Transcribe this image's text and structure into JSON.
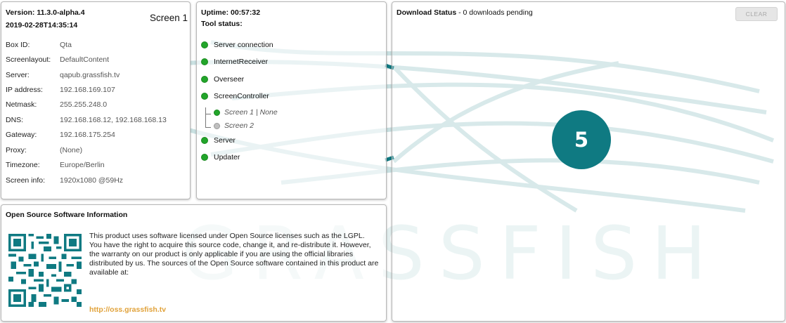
{
  "info": {
    "version": "Version: 11.3.0-alpha.4",
    "date": "2019-02-28T14:35:14",
    "screen": "Screen 1",
    "rows": [
      {
        "key": "Box ID:",
        "value": "Qta"
      },
      {
        "key": "Screenlayout:",
        "value": "DefaultContent"
      },
      {
        "key": "Server:",
        "value": "qapub.grassfish.tv"
      },
      {
        "key": "IP address:",
        "value": "192.168.169.107"
      },
      {
        "key": "Netmask:",
        "value": "255.255.248.0"
      },
      {
        "key": "DNS:",
        "value": "192.168.168.12, 192.168.168.13"
      },
      {
        "key": "Gateway:",
        "value": "192.168.175.254"
      },
      {
        "key": "Proxy:",
        "value": "(None)"
      },
      {
        "key": "Timezone:",
        "value": "Europe/Berlin"
      },
      {
        "key": "Screen info:",
        "value": "1920x1080 @59Hz"
      }
    ]
  },
  "tools": {
    "uptime": "Uptime: 00:57:32",
    "status_label": "Tool status:",
    "items": [
      {
        "label": "Server connection",
        "state": "ok"
      },
      {
        "label": "InternetReceiver",
        "state": "ok"
      },
      {
        "label": "Overseer",
        "state": "ok"
      },
      {
        "label": "ScreenController",
        "state": "ok"
      },
      {
        "label": "Server",
        "state": "ok"
      },
      {
        "label": "Updater",
        "state": "ok"
      }
    ],
    "screens": [
      {
        "label": "Screen 1 | None",
        "state": "ok"
      },
      {
        "label": "Screen 2",
        "state": "inactive"
      }
    ]
  },
  "oss": {
    "title": "Open Source Software Information",
    "text": "This product uses software licensed under Open Source licenses such as the LGPL. You have the right to acquire this source code, change it, and re-distribute it. However, the warranty on our product is only applicable if you are using the official libraries distributed by us. The sources of the Open Source software contained in this product are available at:",
    "link": "http://oss.grassfish.tv"
  },
  "download": {
    "title": "Download Status",
    "status": " - 0 downloads pending",
    "clear_label": "CLEAR"
  },
  "watermark": "GRASSFISH",
  "badge": "5",
  "colors": {
    "accent": "#0f7a82",
    "ok": "#22a52a",
    "inactive": "#bfbfbf",
    "link": "#e1a23a"
  },
  "icons": [
    "status-dot-green",
    "status-dot-grey",
    "qr-code"
  ]
}
